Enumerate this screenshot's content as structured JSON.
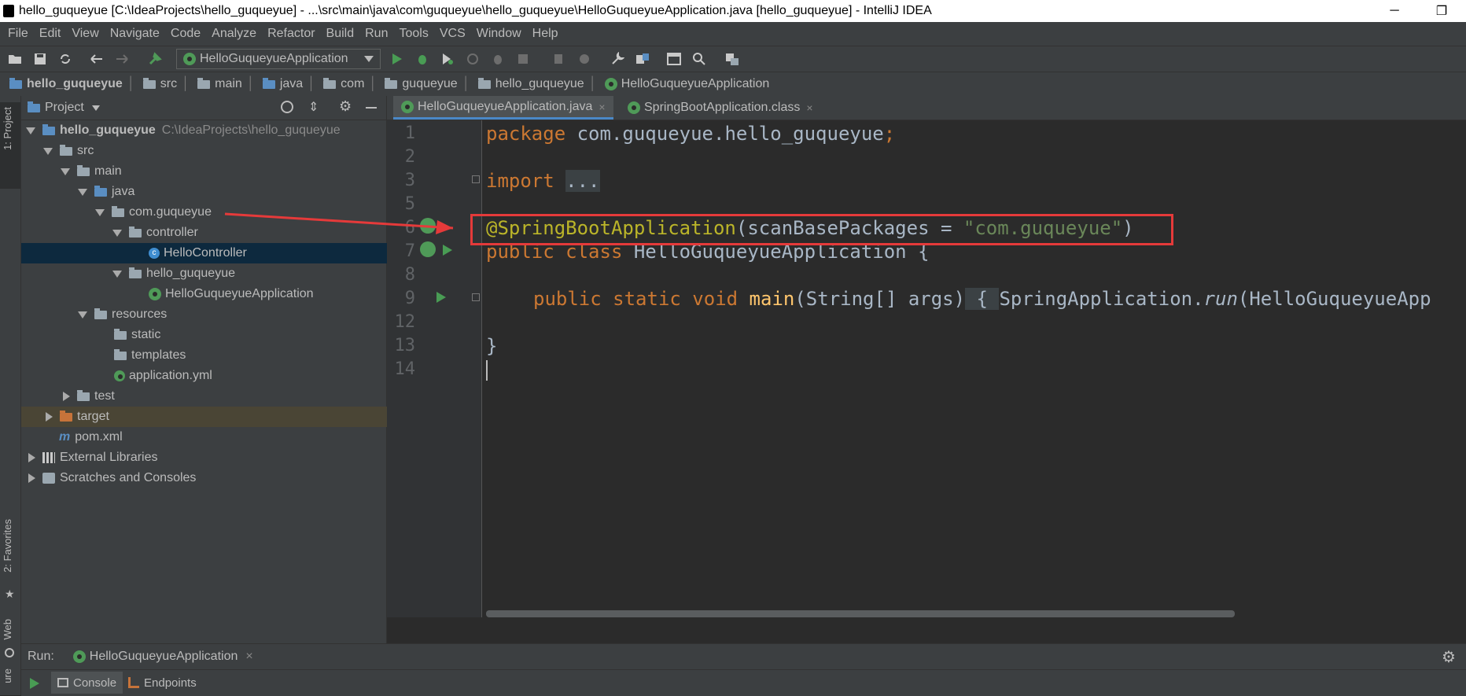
{
  "window": {
    "title": "hello_guqueyue [C:\\IdeaProjects\\hello_guqueyue] - ...\\src\\main\\java\\com\\guqueyue\\hello_guqueyue\\HelloGuqueyueApplication.java [hello_guqueyue] - IntelliJ IDEA",
    "minimize": "─",
    "maximize": "❐"
  },
  "menu": [
    "File",
    "Edit",
    "View",
    "Navigate",
    "Code",
    "Analyze",
    "Refactor",
    "Build",
    "Run",
    "Tools",
    "VCS",
    "Window",
    "Help"
  ],
  "toolbar": {
    "run_config": "HelloGuqueyueApplication"
  },
  "breadcrumbs": [
    "hello_guqueyue",
    "src",
    "main",
    "java",
    "com",
    "guqueyue",
    "hello_guqueyue",
    "HelloGuqueyueApplication"
  ],
  "left_stripe": {
    "project": "1: Project",
    "favorites": "2: Favorites",
    "web": "Web",
    "structure": "ure"
  },
  "project_panel": {
    "title": "Project",
    "tree": [
      {
        "label": "hello_guqueyue",
        "path": "C:\\IdeaProjects\\hello_guqueyue"
      },
      {
        "label": "src"
      },
      {
        "label": "main"
      },
      {
        "label": "java"
      },
      {
        "label": "com.guqueyue"
      },
      {
        "label": "controller"
      },
      {
        "label": "HelloController"
      },
      {
        "label": "hello_guqueyue"
      },
      {
        "label": "HelloGuqueyueApplication"
      },
      {
        "label": "resources"
      },
      {
        "label": "static"
      },
      {
        "label": "templates"
      },
      {
        "label": "application.yml"
      },
      {
        "label": "test"
      },
      {
        "label": "target"
      },
      {
        "label": "pom.xml"
      },
      {
        "label": "External Libraries"
      },
      {
        "label": "Scratches and Consoles"
      }
    ]
  },
  "editor": {
    "tabs": [
      {
        "label": "HelloGuqueyueApplication.java",
        "close": "×"
      },
      {
        "label": "SpringBootApplication.class",
        "close": "×"
      }
    ],
    "line_numbers": [
      "1",
      "2",
      "3",
      "5",
      "6",
      "7",
      "8",
      "9",
      "12",
      "13",
      "14"
    ],
    "code": {
      "l1_kw": "package",
      "l1_rest": " com.guqueyue.hello_guqueyue",
      "l1_semi": ";",
      "l3_kw": "import",
      "l3_fold": "...",
      "l6_ann": "@SpringBootApplication",
      "l6_a": "(scanBasePackages = ",
      "l6_str": "\"com.guqueyue\"",
      "l6_b": ")",
      "l7_kw": "public class",
      "l7_rest": " HelloGuqueyueApplication {",
      "l9_kw": "public static void",
      "l9_fn": "main",
      "l9_a": "(String[] args)",
      "l9_fold": " { ",
      "l9_b": "SpringApplication.",
      "l9_run": "run",
      "l9_c": "(HelloGuqueyueApp",
      "l13": "}"
    }
  },
  "run_panel": {
    "label": "Run:",
    "config": "HelloGuqueyueApplication",
    "close": "×",
    "console": "Console",
    "endpoints": "Endpoints"
  },
  "colors": {
    "keyword": "#cc7832",
    "annotation": "#bbb529",
    "string": "#6a8759",
    "highlight_box": "#e53a3a"
  }
}
